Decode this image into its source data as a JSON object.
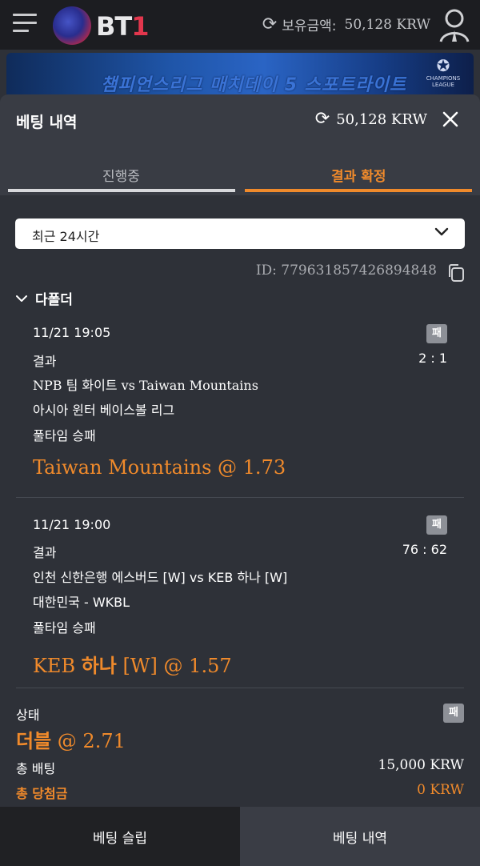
{
  "header": {
    "logo_text": "BT",
    "logo_one": "1",
    "balance_label": "보유금액:",
    "balance_value": "50,128 KRW"
  },
  "banner": {
    "text": "챔피언스리그 매치데이 5 스포트라이트",
    "badge_text": "CHAMPIONS LEAGUE"
  },
  "panel": {
    "title": "베팅 내역",
    "balance": "50,128 KRW",
    "tabs": [
      {
        "label": "진행중",
        "active": false
      },
      {
        "label": "결과 확정",
        "active": true
      }
    ],
    "filter_value": "최근 24시간",
    "bet_id": "ID: 779631857426894848",
    "bet_type_header": "다폴더"
  },
  "bets": [
    {
      "datetime": "11/21 19:05",
      "result_badge": "패",
      "result_label": "결과",
      "score": "2 : 1",
      "match": "NPB 팀 화이트 vs Taiwan Mountains",
      "league": "아시아 윈터 베이스볼 리그",
      "market": "풀타임 승패",
      "pick_prefix": "",
      "pick": "Taiwan Mountains @ 1.73"
    },
    {
      "datetime": "11/21 19:00",
      "result_badge": "패",
      "result_label": "결과",
      "score": "76 : 62",
      "match": "인천 신한은행 에스버드 [W] vs KEB 하나 [W]",
      "league": "대한민국 - WKBL",
      "market": "풀타임 승패",
      "pick_prefix": "KEB ",
      "pick_bold": "하나",
      "pick": " [W] @ 1.57"
    }
  ],
  "summary": {
    "status_label": "상태",
    "status_badge": "패",
    "type_bold": "더블",
    "type_odds": " @ 2.71",
    "total_bet_label": "총 배팅",
    "total_bet_value": "15,000 KRW",
    "total_win_label": "총 당첨금",
    "total_win_value": "0 KRW"
  },
  "bottom_nav": {
    "slip_label": "베팅 슬립",
    "history_label": "베팅 내역"
  },
  "colors": {
    "accent": "#f08a2b",
    "panel_bg": "#2e3138",
    "header_bg": "#1c1d21"
  }
}
